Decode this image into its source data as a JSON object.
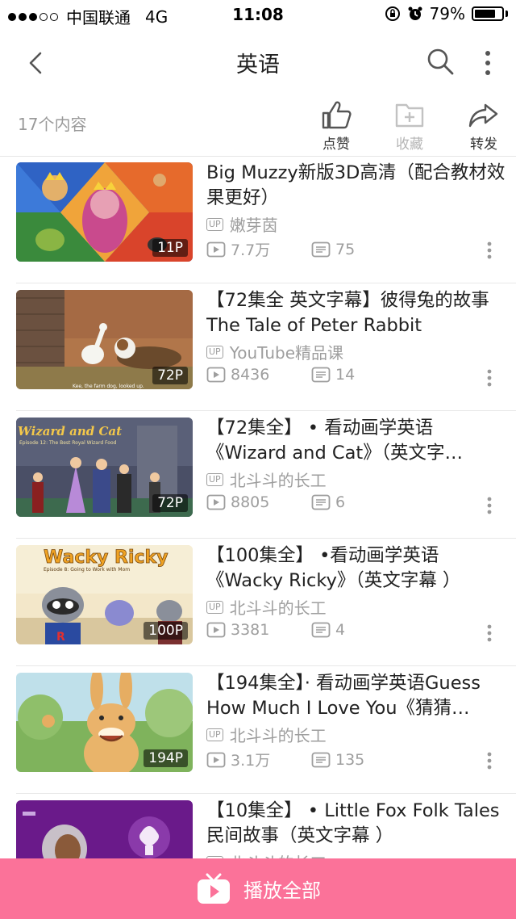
{
  "status_bar": {
    "carrier": "中国联通",
    "network": "4G",
    "time": "11:08",
    "battery": "79%",
    "battery_level": 0.79,
    "signal_bars": 3
  },
  "nav": {
    "title": "英语",
    "icons": [
      "back-arrow-icon",
      "search-icon",
      "more-vertical-icon"
    ]
  },
  "header": {
    "count_text": "17个内容",
    "actions": [
      {
        "label": "点赞",
        "icon": "thumbs-up-icon",
        "enabled": true
      },
      {
        "label": "收藏",
        "icon": "add-folder-icon",
        "enabled": false
      },
      {
        "label": "转发",
        "icon": "share-icon",
        "enabled": true
      }
    ]
  },
  "videos": [
    {
      "title": "Big  Muzzy新版3D高清（配合教材效果更好）",
      "uploader": "嫩芽茵",
      "plays": "7.7万",
      "danmaku": "75",
      "parts": "11P"
    },
    {
      "title": "【72集全  英文字幕】彼得兔的故事The  Tale  of  Peter  Rabbit",
      "uploader": "YouTube精品课",
      "plays": "8436",
      "danmaku": "14",
      "parts": "72P"
    },
    {
      "title": "【72集全】 •  看动画学英语《Wizard  and  Cat》（英文字…",
      "uploader": "北斗斗的长工",
      "plays": "8805",
      "danmaku": "6",
      "parts": "72P"
    },
    {
      "title": "【100集全】 •看动画学英语《Wacky  Ricky》（英文字幕  ）",
      "uploader": "北斗斗的长工",
      "plays": "3381",
      "danmaku": "4",
      "parts": "100P"
    },
    {
      "title": "【194集全】·  看动画学英语Guess How  Much  I  Love  You《猜猜…",
      "uploader": "北斗斗的长工",
      "plays": "3.1万",
      "danmaku": "135",
      "parts": "194P"
    },
    {
      "title": "【10集全】 •  Little  Fox  Folk Tales  民间故事（英文字幕  ）",
      "uploader": "北斗斗的长工",
      "plays": "",
      "danmaku": "",
      "parts": ""
    }
  ],
  "thumb_texts": {
    "wizard_title": "Wizard and Cat",
    "wizard_sub": "Episode 12: The Best Royal Wizard Food",
    "wacky_title": "Wacky Ricky",
    "wacky_sub": "Episode 8: Going to Work with Mom",
    "rabbit_caption": "Kee, the farm dog, looked up."
  },
  "up_tag": "UP",
  "play_all": {
    "label": "播放全部",
    "icon": "tv-play-icon"
  },
  "colors": {
    "accent": "#fb7299",
    "muted": "#9e9e9e"
  }
}
